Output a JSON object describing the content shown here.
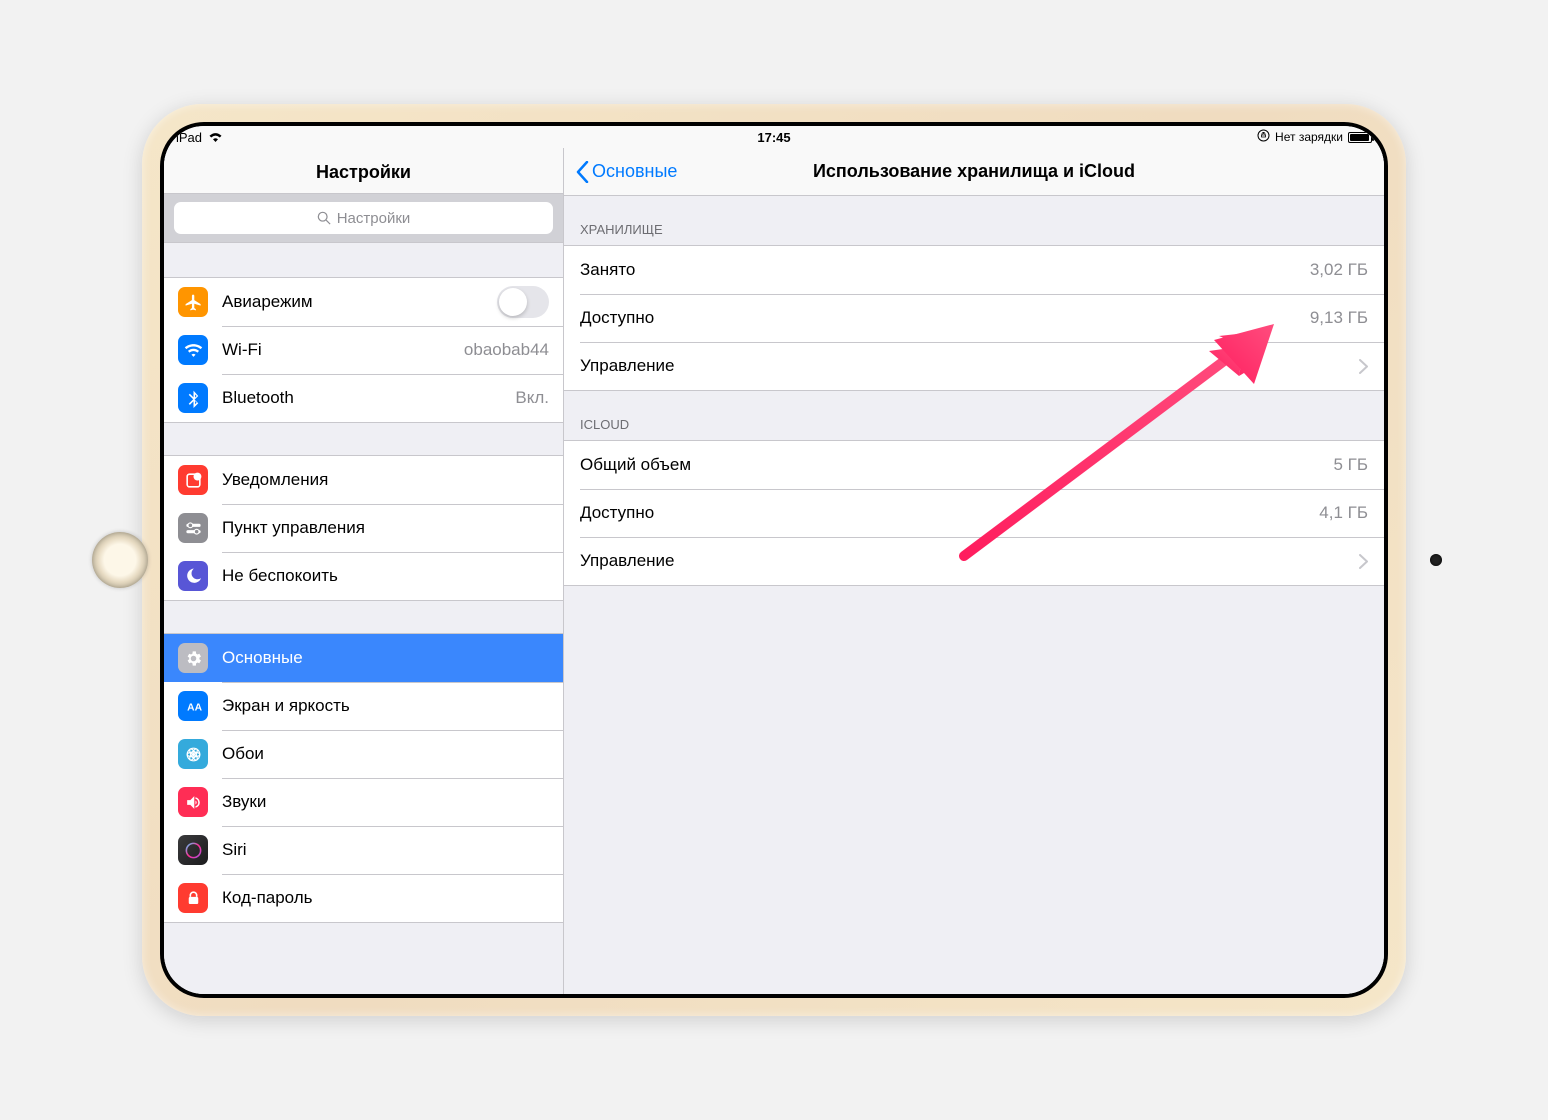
{
  "statusBar": {
    "device": "iPad",
    "time": "17:45",
    "chargeText": "Нет зарядки"
  },
  "sidebar": {
    "title": "Настройки",
    "searchPlaceholder": "Настройки",
    "group1": {
      "airplane": {
        "label": "Авиарежим"
      },
      "wifi": {
        "label": "Wi-Fi",
        "value": "obaobab44"
      },
      "bluetooth": {
        "label": "Bluetooth",
        "value": "Вкл."
      }
    },
    "group2": {
      "notifications": {
        "label": "Уведомления"
      },
      "controlCenter": {
        "label": "Пункт управления"
      },
      "dnd": {
        "label": "Не беспокоить"
      }
    },
    "group3": {
      "general": {
        "label": "Основные"
      },
      "display": {
        "label": "Экран и яркость"
      },
      "wallpaper": {
        "label": "Обои"
      },
      "sounds": {
        "label": "Звуки"
      },
      "siri": {
        "label": "Siri"
      },
      "passcode": {
        "label": "Код-пароль"
      }
    }
  },
  "detail": {
    "back": "Основные",
    "title": "Использование хранилища и iCloud",
    "storage": {
      "header": "ХРАНИЛИЩЕ",
      "used": {
        "label": "Занято",
        "value": "3,02 ГБ"
      },
      "available": {
        "label": "Доступно",
        "value": "9,13 ГБ"
      },
      "manage": {
        "label": "Управление"
      }
    },
    "icloud": {
      "header": "ICLOUD",
      "total": {
        "label": "Общий объем",
        "value": "5 ГБ"
      },
      "available": {
        "label": "Доступно",
        "value": "4,1 ГБ"
      },
      "manage": {
        "label": "Управление"
      }
    }
  }
}
